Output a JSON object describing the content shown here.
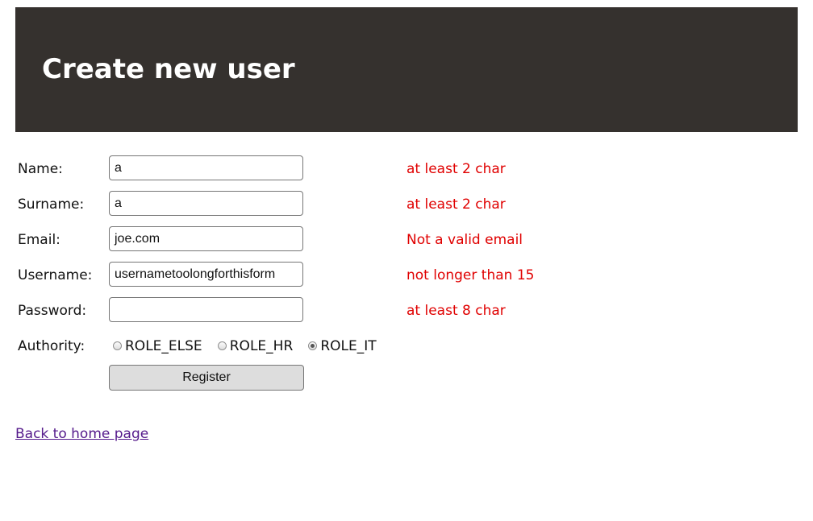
{
  "header": {
    "title": "Create new user"
  },
  "form": {
    "fields": [
      {
        "label": "Name:",
        "value": "a",
        "error": "at least 2 char"
      },
      {
        "label": "Surname:",
        "value": "a",
        "error": "at least 2 char"
      },
      {
        "label": "Email:",
        "value": "joe.com",
        "error": "Not a valid email"
      },
      {
        "label": "Username:",
        "value": "usernametoolongforthisform",
        "error": "not longer than 15"
      },
      {
        "label": "Password:",
        "value": "",
        "error": "at least 8 char"
      }
    ],
    "authority": {
      "label": "Authority:",
      "options": [
        "ROLE_ELSE",
        "ROLE_HR",
        "ROLE_IT"
      ],
      "selected": "ROLE_IT"
    },
    "register_label": "Register"
  },
  "back_link": "Back to home page",
  "colors": {
    "header_bg": "#35312e",
    "error": "#e00000",
    "link": "#551a8b"
  }
}
